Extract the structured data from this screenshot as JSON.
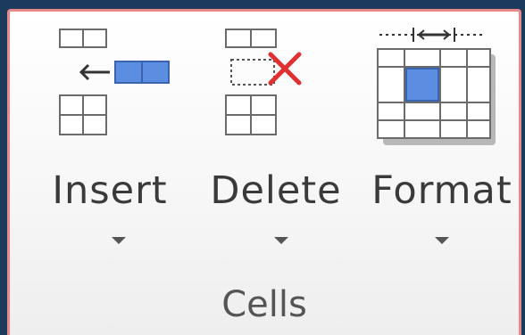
{
  "group": {
    "label": "Cells"
  },
  "commands": [
    {
      "label": "Insert",
      "icon": "insert-cells-icon"
    },
    {
      "label": "Delete",
      "icon": "delete-cells-icon"
    },
    {
      "label": "Format",
      "icon": "format-cells-icon"
    }
  ],
  "colors": {
    "highlight_border": "#e88888",
    "accent_blue": "#5b8de0",
    "delete_red": "#e03030"
  }
}
